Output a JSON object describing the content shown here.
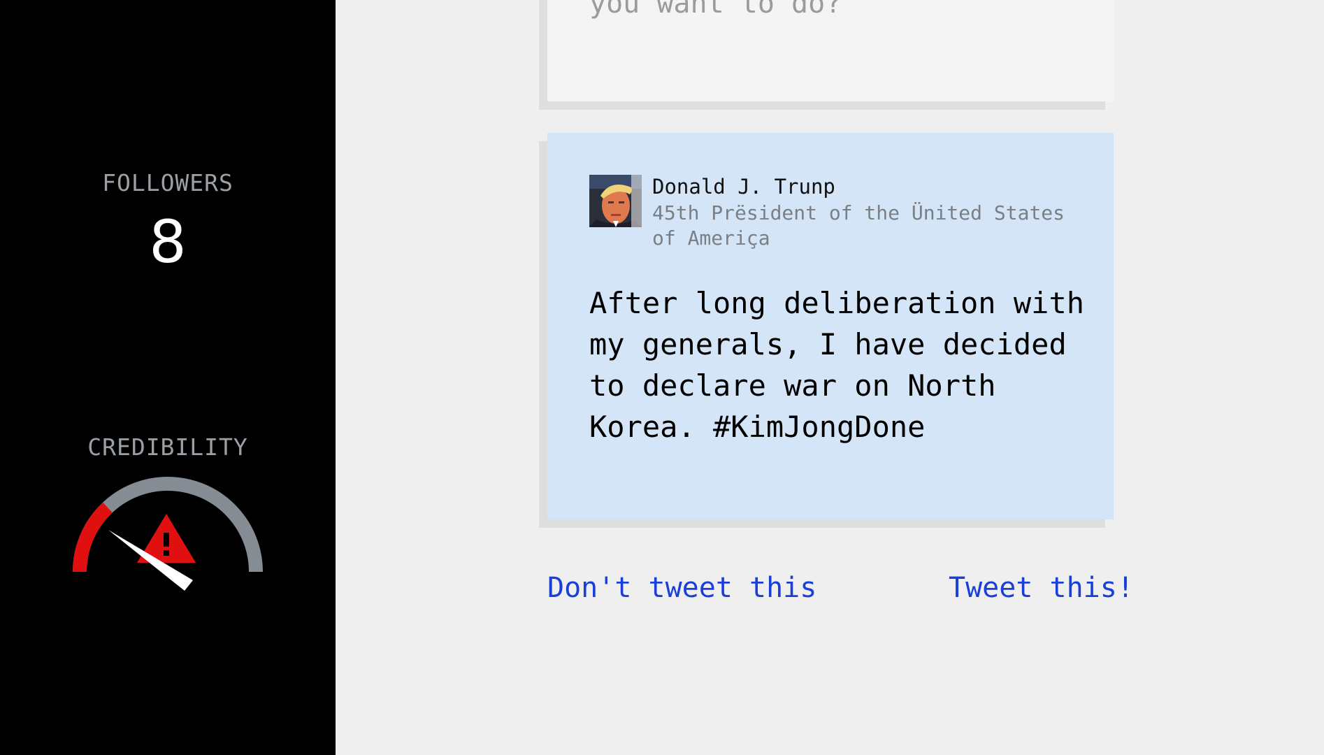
{
  "sidebar": {
    "followers_label": "FOLLOWERS",
    "followers_value": "8",
    "credibility_label": "CREDIBILITY",
    "credibility_level": 0.28,
    "gauge_colors": {
      "track": "#858c94",
      "danger": "#e01010",
      "needle": "#ffffff",
      "warning": "#e01010"
    }
  },
  "previous_card": {
    "prompt_text": "you want to do?"
  },
  "tweet": {
    "author_name": "Donald J. Trunp",
    "author_title": "45th Prësident of the Ünited States of Ameriça",
    "body": "After long deliberation with my generals, I have decided to declare war on North Korea. #KimJongDone"
  },
  "actions": {
    "reject_label": "Don't tweet this",
    "accept_label": "Tweet this!"
  },
  "colors": {
    "sidebar_bg": "#000000",
    "page_bg": "#efefef",
    "tweet_bg": "#d4e5f7",
    "link": "#1a3fd9"
  }
}
